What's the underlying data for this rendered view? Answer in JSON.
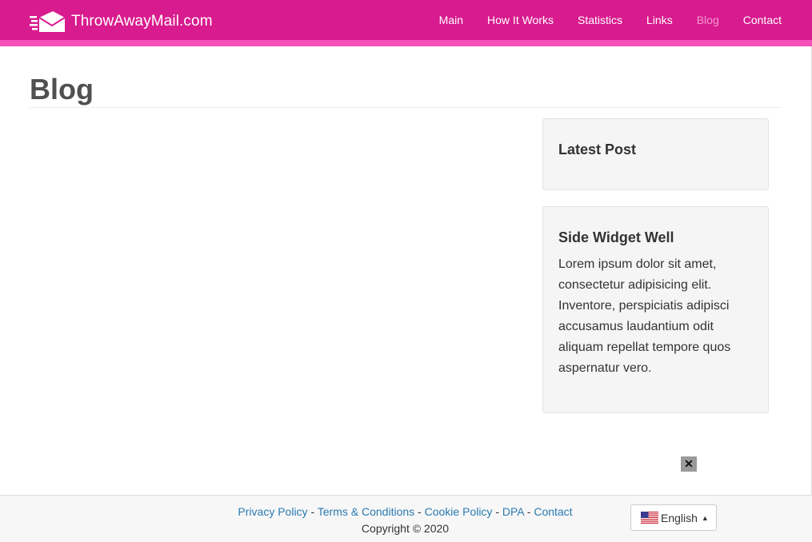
{
  "navbar": {
    "brand": "ThrowAwayMail.com",
    "items": [
      {
        "label": "Main",
        "active": false
      },
      {
        "label": "How It Works",
        "active": false
      },
      {
        "label": "Statistics",
        "active": false
      },
      {
        "label": "Links",
        "active": false
      },
      {
        "label": "Blog",
        "active": true
      },
      {
        "label": "Contact",
        "active": false
      }
    ],
    "colors": {
      "bar": "#d81b8e",
      "stripe": "#f54fb9",
      "active": "#f59bd0"
    }
  },
  "page": {
    "title": "Blog"
  },
  "sidebar": {
    "latest_post": {
      "heading": "Latest Post"
    },
    "side_widget": {
      "heading": "Side Widget Well",
      "body": "Lorem ipsum dolor sit amet, consectetur adipisicing elit. Inventore, perspiciatis adipisci accusamus laudantium odit aliquam repellat tempore quos aspernatur vero."
    }
  },
  "ad": {
    "close_label": "✕"
  },
  "footer": {
    "links": [
      "Privacy Policy",
      "Terms & Conditions",
      "Cookie Policy",
      "DPA",
      "Contact"
    ],
    "separator": " - ",
    "copyright": "Copyright © 2020",
    "language": {
      "label": "English",
      "flag_icon": "us-flag-icon",
      "caret": "▲"
    }
  }
}
